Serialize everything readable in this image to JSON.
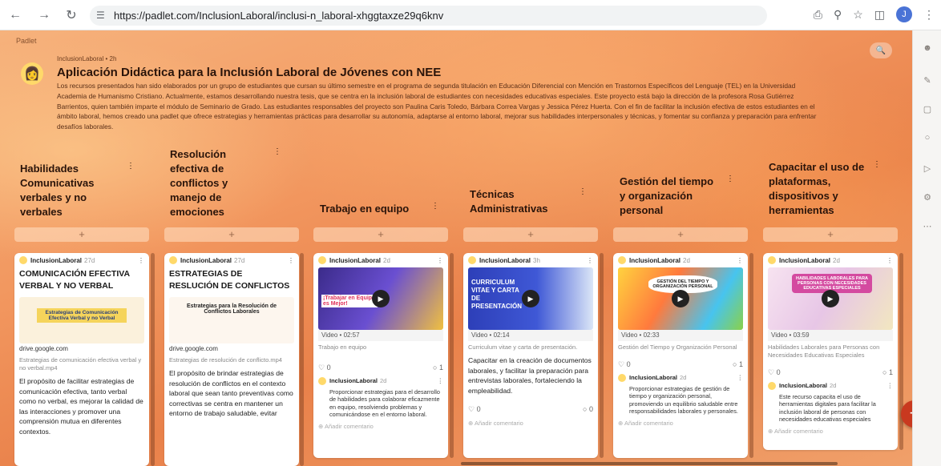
{
  "browser": {
    "url": "https://padlet.com/InclusionLaboral/inclusi-n_laboral-xhggtaxze29q6knv",
    "profile_initial": "J"
  },
  "board": {
    "logo": "Padlet",
    "owner_meta": "InclusionLaboral • 2h",
    "title": "Aplicación Didáctica para la Inclusión Laboral de Jóvenes con NEE",
    "description": "Los recursos presentados han sido elaborados por un grupo de estudiantes que cursan su último semestre en el programa de segunda titulación en Educación Diferencial con Mención en Trastornos Específicos del Lenguaje (TEL) en la Universidad Academia de Humanismo Cristiano. Actualmente, estamos desarrollando nuestra tesis, que se centra en la inclusión laboral de estudiantes con necesidades educativas especiales. Este proyecto está bajo la dirección de la profesora Rosa Gutiérrez Barrientos, quien también imparte el módulo de Seminario de Grado. Las estudiantes responsables del proyecto son Paulina Caris Toledo, Bárbara Correa Vargas y Jessica Pérez Huerta. Con el fin de facilitar la inclusión efectiva de estos estudiantes en el ámbito laboral, hemos creado una padlet que ofrece estrategias y herramientas prácticas para desarrollar su autonomía, adaptarse al entorno laboral, mejorar sus habilidades interpersonales y técnicas, y fomentar su confianza y preparación para enfrentar desafíos laborales.",
    "add_symbol": "+",
    "fab_symbol": "+"
  },
  "columns": [
    {
      "heading": "Habilidades Comunicativas verbales y no verbales"
    },
    {
      "heading": "Resolución efectiva de conflictos y manejo de emociones"
    },
    {
      "heading": "Trabajo en equipo"
    },
    {
      "heading": "Técnicas Administrativas"
    },
    {
      "heading": "Gestión del tiempo y organización personal"
    },
    {
      "heading": "Capacitar el uso de plataformas, dispositivos y herramientas"
    }
  ],
  "cards": [
    {
      "author": "InclusionLaboral",
      "time": "27d",
      "title": "COMUNICACIÓN EFECTIVA VERBAL Y NO VERBAL",
      "thumb_text": "Estrategias de Comunicación Efectiva Verbal y no Verbal",
      "link": "drive.google.com",
      "caption": "Estrategias de comunicación efectiva verbal y no verbal.mp4",
      "body": "El propósito de facilitar estrategias de comunicación efectiva, tanto verbal como no verbal, es mejorar la calidad de las interacciones y promover una comprensión mutua en diferentes contextos."
    },
    {
      "author": "InclusionLaboral",
      "time": "27d",
      "title": "ESTRATEGIAS DE RESLUCIÓN DE CONFLICTOS",
      "thumb_text": "Estrategias para la Resolución de Conflictos Laborales",
      "link": "drive.google.com",
      "caption": "Estrategias de resolución de conflicto.mp4",
      "body": "El propósito de brindar estrategias de resolución de conflictos en el contexto laboral que sean tanto preventivas como correctivas se centra en mantener un entorno de trabajo saludable, evitar"
    },
    {
      "author": "InclusionLaboral",
      "time": "2d",
      "thumb_text": "¡Trabajar en Equipo es Mejor!",
      "video": "Video • 02:57",
      "caption": "Trabajo en equipo",
      "likes": "0",
      "comments": "1",
      "comment_author": "InclusionLaboral",
      "comment_time": "2d",
      "comment_text": "Proporcionar estrategias para el desarrollo de habilidades para colaborar eficazmente en equipo, resolviendo problemas y comunicándose en el entorno laboral.",
      "add_comment": "Añadir comentario"
    },
    {
      "author": "InclusionLaboral",
      "time": "3h",
      "thumb_text": "CURRICULUM VITAE Y CARTA DE PRESENTACIÓN",
      "video": "Video • 02:14",
      "caption": "Curriculum vitae y carta de presentación.",
      "body": "Capacitar en la creación de documentos laborales, y facilitar la preparación para entrevistas laborales, fortaleciendo la empleabilidad.",
      "likes": "0",
      "comments": "0",
      "add_comment": "Añadir comentario"
    },
    {
      "author": "InclusionLaboral",
      "time": "2d",
      "thumb_text": "GESTIÓN DEL TIEMPO Y ORGANIZACIÓN PERSONAL",
      "video": "Video • 02:33",
      "caption": "Gestión del Tiempo y Organización Personal",
      "likes": "0",
      "comments": "1",
      "comment_author": "InclusionLaboral",
      "comment_time": "2d",
      "comment_text": "Proporcionar estrategias de gestión de tiempo y organización personal, promoviendo un equilibrio saludable entre responsabilidades laborales y personales.",
      "add_comment": "Añadir comentario"
    },
    {
      "author": "InclusionLaboral",
      "time": "2d",
      "thumb_text": "HABILIDADES LABORALES PARA PERSONAS CON NECESIDADES EDUCATIVAS ESPECIALES",
      "video": "Video • 03:59",
      "caption": "Habilidades Laborales para Personas con Necesidades Educativas Especiales",
      "likes": "0",
      "comments": "1",
      "comment_author": "InclusionLaboral",
      "comment_time": "2d",
      "comment_text": "Este recurso capacita el uso de herramientas digitales para facilitar la inclusión laboral de personas con necesidades educativas especiales",
      "add_comment": "Añadir comentario"
    }
  ]
}
